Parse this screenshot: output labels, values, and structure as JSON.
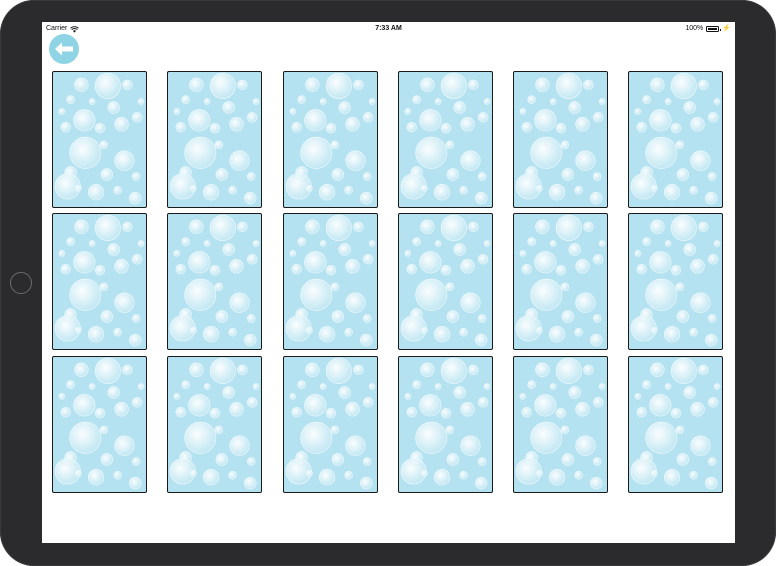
{
  "status_bar": {
    "carrier": "Carrier",
    "time": "7:33 AM",
    "battery": "100%",
    "icons": [
      "wifi-icon",
      "battery-icon",
      "charging-bolt-icon"
    ]
  },
  "navigation": {
    "back_icon": "arrow-left-icon"
  },
  "board": {
    "rows": 3,
    "columns": 6,
    "card_state": "face-down",
    "card_back_pattern": "bubbles",
    "card_back_color": "#b4e2f0",
    "accent_color": "#8fd4e4"
  }
}
